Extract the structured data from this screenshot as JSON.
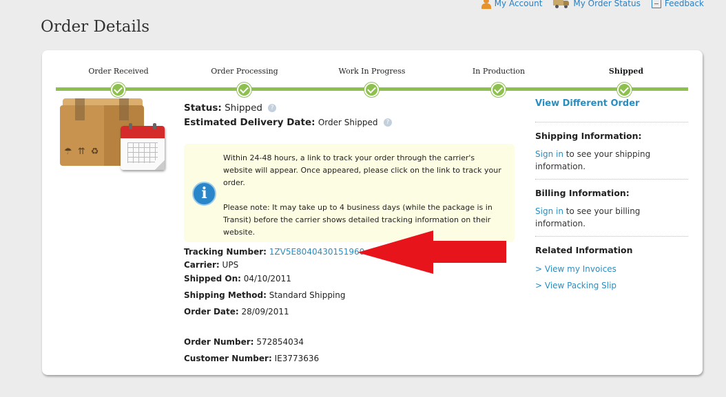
{
  "top_links": {
    "account": "My Account",
    "order_status": "My Order Status",
    "feedback": "Feedback"
  },
  "page_title": "Order Details",
  "steps": [
    {
      "label": "Order Received",
      "done": true
    },
    {
      "label": "Order Processing",
      "done": true
    },
    {
      "label": "Work In Progress",
      "done": true
    },
    {
      "label": "In Production",
      "done": true
    },
    {
      "label": "Shipped",
      "done": true,
      "current": true
    }
  ],
  "status": {
    "label": "Status:",
    "value": "Shipped"
  },
  "delivery": {
    "label": "Estimated Delivery Date:",
    "value": "Order Shipped"
  },
  "notice": {
    "paragraph1": "Within 24-48 hours, a link to track your order through the carrier's website will appear. Once appeared, please click on the link to track your order.",
    "paragraph2": "Please note: It may take up to 4 business days (while the package is in Transit) before the carrier shows detailed tracking information on their website."
  },
  "details": {
    "tracking_label": "Tracking Number:",
    "tracking_value": "1ZV5E8040430151960",
    "carrier_label": "Carrier:",
    "carrier_value": "UPS",
    "shipped_on_label": "Shipped On:",
    "shipped_on_value": "04/10/2011",
    "shipping_method_label": "Shipping Method:",
    "shipping_method_value": "Standard Shipping",
    "order_date_label": "Order Date:",
    "order_date_value": "28/09/2011",
    "order_number_label": "Order Number:",
    "order_number_value": "572854034",
    "customer_number_label": "Customer Number:",
    "customer_number_value": "IE3773636"
  },
  "sidebar": {
    "view_different_order": "View Different Order",
    "shipping_heading": "Shipping Information:",
    "shipping_signin": "Sign in",
    "shipping_text": " to see your shipping information.",
    "billing_heading": "Billing Information:",
    "billing_signin": "Sign in",
    "billing_text": " to see your billing information.",
    "related_heading": "Related Information",
    "invoices_link": "> View my Invoices",
    "packing_slip_link": "> View Packing Slip"
  },
  "colors": {
    "accent_green": "#8dc04e",
    "link_blue": "#2a8dc0",
    "annotation_arrow": "#e8141b",
    "notice_bg": "#fdfde3"
  }
}
